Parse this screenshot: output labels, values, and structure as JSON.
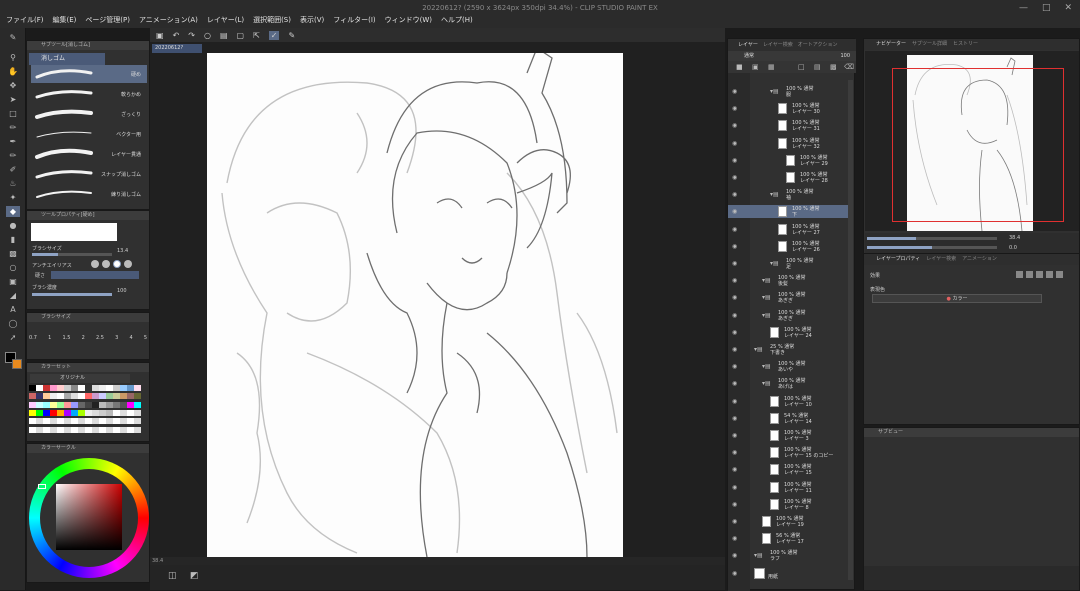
{
  "title": "20220612? (2590 x 3624px 350dpi 34.4%) - CLIP STUDIO PAINT EX",
  "menu": [
    "ファイル(F)",
    "編集(E)",
    "ページ管理(P)",
    "アニメーション(A)",
    "レイヤー(L)",
    "選択範囲(S)",
    "表示(V)",
    "フィルター(I)",
    "ウィンドウ(W)",
    "ヘルプ(H)"
  ],
  "subtool": {
    "header": "サブツール[消しゴム]",
    "active_tab": "消しゴム",
    "brushes": [
      "硬め",
      "軟らかめ",
      "ざっくり",
      "ベクター用",
      "レイヤー貫通",
      "スナップ消しゴム",
      "練り消しゴム"
    ]
  },
  "toolprop": {
    "header": "ツールプロパティ[硬め]",
    "brush_size_label": "ブラシサイズ",
    "brush_size_value": "13.4",
    "antialias_label": "アンチエイリアス",
    "hardness_label": "硬さ",
    "density_label": "ブラシ濃度",
    "density_value": "100"
  },
  "brushsize": {
    "header": "ブラシサイズ",
    "values": [
      "0.7",
      "1",
      "1.5",
      "2",
      "2.5",
      "3",
      "4",
      "5"
    ]
  },
  "colorset": {
    "header": "カラーセット",
    "set_name": "オリジナル"
  },
  "colorwheel": {
    "header": "カラーサークル"
  },
  "canvas": {
    "doc_tab": "20220612?",
    "zoom": "38.4",
    "bottom_zoom": "38.4"
  },
  "layer_panel": {
    "tabs": [
      "レイヤー",
      "レイヤー検索",
      "オートアクション"
    ],
    "blend_mode": "通常",
    "opacity": "100"
  },
  "layers": [
    {
      "top": "100 % 通常",
      "name": "服",
      "type": "folder",
      "depth": 2
    },
    {
      "top": "100 % 通常",
      "name": "レイヤー 30",
      "type": "layer",
      "depth": 3
    },
    {
      "top": "100 % 通常",
      "name": "レイヤー 31",
      "type": "layer",
      "depth": 3
    },
    {
      "top": "100 % 通常",
      "name": "レイヤー 32",
      "type": "layer",
      "depth": 3
    },
    {
      "top": "100 % 通常",
      "name": "レイヤー 29",
      "type": "layer",
      "depth": 4
    },
    {
      "top": "100 % 通常",
      "name": "レイヤー 28",
      "type": "layer",
      "depth": 4
    },
    {
      "top": "100 % 通常",
      "name": "袖",
      "type": "folder",
      "depth": 2
    },
    {
      "top": "100 % 通常",
      "name": "下",
      "type": "layer",
      "depth": 3,
      "selected": true
    },
    {
      "top": "100 % 通常",
      "name": "レイヤー 27",
      "type": "layer",
      "depth": 3
    },
    {
      "top": "100 % 通常",
      "name": "レイヤー 26",
      "type": "layer",
      "depth": 3
    },
    {
      "top": "100 % 通常",
      "name": "足",
      "type": "folder",
      "depth": 2
    },
    {
      "top": "100 % 通常",
      "name": "後髪",
      "type": "folder",
      "depth": 1
    },
    {
      "top": "100 % 通常",
      "name": "あぎぎ",
      "type": "folder",
      "depth": 1
    },
    {
      "top": "100 % 通常",
      "name": "あぎぎ",
      "type": "folder",
      "depth": 1
    },
    {
      "top": "100 % 通常",
      "name": "レイヤー 24",
      "type": "layer",
      "depth": 2
    },
    {
      "top": "25 % 通常",
      "name": "下書き",
      "type": "folder",
      "depth": 0
    },
    {
      "top": "100 % 通常",
      "name": "あいや",
      "type": "folder",
      "depth": 1
    },
    {
      "top": "100 % 通常",
      "name": "あげは",
      "type": "folder",
      "depth": 1
    },
    {
      "top": "100 % 通常",
      "name": "レイヤー 10",
      "type": "layer",
      "depth": 2
    },
    {
      "top": "54 % 通常",
      "name": "レイヤー 14",
      "type": "layer",
      "depth": 2
    },
    {
      "top": "100 % 通常",
      "name": "レイヤー 3",
      "type": "layer",
      "depth": 2
    },
    {
      "top": "100 % 通常",
      "name": "レイヤー 15 のコピー",
      "type": "layer",
      "depth": 2
    },
    {
      "top": "100 % 通常",
      "name": "レイヤー 15",
      "type": "layer",
      "depth": 2
    },
    {
      "top": "100 % 通常",
      "name": "レイヤー 11",
      "type": "layer",
      "depth": 2
    },
    {
      "top": "100 % 通常",
      "name": "レイヤー 8",
      "type": "layer",
      "depth": 2
    },
    {
      "top": "100 % 通常",
      "name": "レイヤー 19",
      "type": "layer",
      "depth": 1
    },
    {
      "top": "56 % 通常",
      "name": "レイヤー 17",
      "type": "layer",
      "depth": 1
    },
    {
      "top": "100 % 通常",
      "name": "ラフ",
      "type": "folder",
      "depth": 0
    },
    {
      "top": "",
      "name": "用紙",
      "type": "paper",
      "depth": 0
    }
  ],
  "navigator": {
    "tabs": [
      "ナビゲーター",
      "サブツール詳細",
      "ヒストリー"
    ],
    "zoom": "38.4",
    "angle": "0.0"
  },
  "layer_property": {
    "tabs": [
      "レイヤープロパティ",
      "レイヤー検索",
      "アニメーション"
    ],
    "effect_label": "効果",
    "color_label": "表現色",
    "color_value": "カラー"
  },
  "subview": {
    "header": "サブビュー"
  },
  "colors": {
    "accent": "#5a6a86",
    "fg_color": "#000000",
    "bg_color": "#e88a1e",
    "nav_frame": "#e03030"
  }
}
